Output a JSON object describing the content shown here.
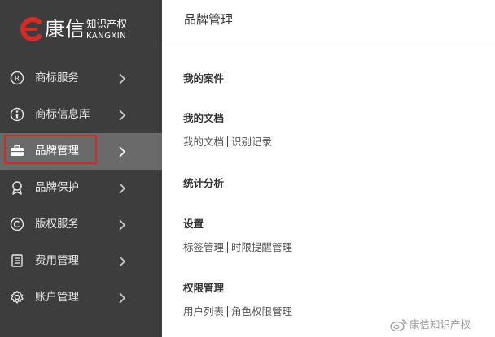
{
  "brand": {
    "name": "康信",
    "subtitle": "知识产权",
    "english": "KANGXIN",
    "accent_color": "#d62b22"
  },
  "sidebar": {
    "background": "#3d3d3d",
    "active_background": "#6a6a6a",
    "items": [
      {
        "label": "商标服务",
        "icon": "registered-icon",
        "active": false
      },
      {
        "label": "商标信息库",
        "icon": "database-icon",
        "active": false
      },
      {
        "label": "品牌管理",
        "icon": "briefcase-icon",
        "active": true
      },
      {
        "label": "品牌保护",
        "icon": "award-icon",
        "active": false
      },
      {
        "label": "版权服务",
        "icon": "copyright-icon",
        "active": false
      },
      {
        "label": "费用管理",
        "icon": "document-icon",
        "active": false
      },
      {
        "label": "账户管理",
        "icon": "gear-icon",
        "active": false
      }
    ]
  },
  "main": {
    "title": "品牌管理",
    "sections": [
      {
        "heading": "我的案件",
        "links": []
      },
      {
        "heading": "我的文档",
        "links": [
          "我的文档",
          "识别记录"
        ]
      },
      {
        "heading": "统计分析",
        "links": []
      },
      {
        "heading": "设置",
        "links": [
          "标签管理",
          "时限提醒管理"
        ]
      },
      {
        "heading": "权限管理",
        "links": [
          "用户列表",
          "角色权限管理"
        ]
      }
    ]
  },
  "watermark": {
    "text": "康信知识产权",
    "icon": "weibo-icon"
  }
}
